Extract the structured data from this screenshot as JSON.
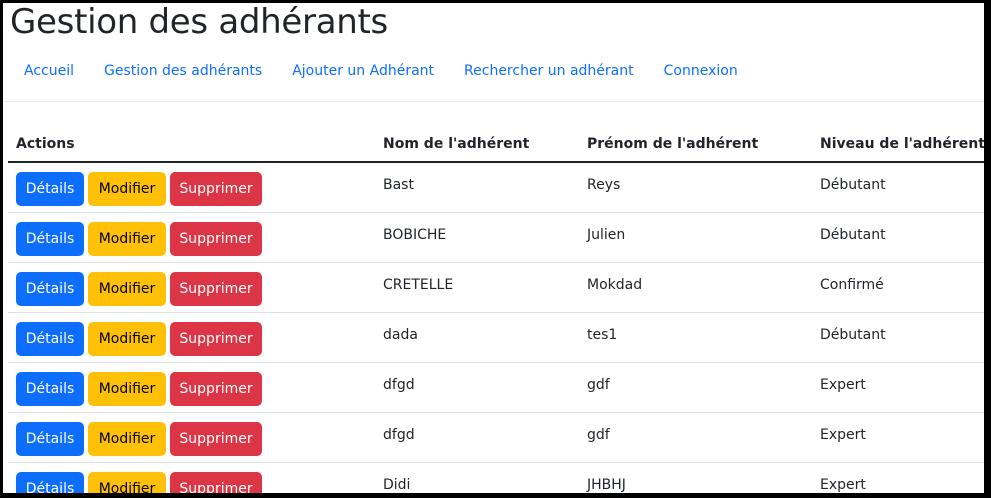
{
  "page": {
    "title": "Gestion des adhérants"
  },
  "nav": {
    "items": [
      {
        "label": "Accueil"
      },
      {
        "label": "Gestion des adhérants"
      },
      {
        "label": "Ajouter un Adhérant"
      },
      {
        "label": "Rechercher un adhérant"
      },
      {
        "label": "Connexion"
      }
    ]
  },
  "table": {
    "headers": {
      "actions": "Actions",
      "nom": "Nom de l'adhérent",
      "prenom": "Prénom de l'adhérent",
      "niveau": "Niveau de l'adhérent"
    },
    "button_labels": {
      "details": "Détails",
      "modifier": "Modifier",
      "supprimer": "Supprimer"
    },
    "rows": [
      {
        "nom": "Bast",
        "prenom": "Reys",
        "niveau": "Débutant"
      },
      {
        "nom": "BOBICHE",
        "prenom": "Julien",
        "niveau": "Débutant"
      },
      {
        "nom": "CRETELLE",
        "prenom": "Mokdad",
        "niveau": "Confirmé"
      },
      {
        "nom": "dada",
        "prenom": "tes1",
        "niveau": "Débutant"
      },
      {
        "nom": "dfgd",
        "prenom": "gdf",
        "niveau": "Expert"
      },
      {
        "nom": "dfgd",
        "prenom": "gdf",
        "niveau": "Expert"
      },
      {
        "nom": "Didi",
        "prenom": "JHBHJ",
        "niveau": "Expert"
      }
    ]
  },
  "colors": {
    "primary": "#0d6efd",
    "warning": "#ffc107",
    "danger": "#dc3545",
    "text": "#212529"
  }
}
